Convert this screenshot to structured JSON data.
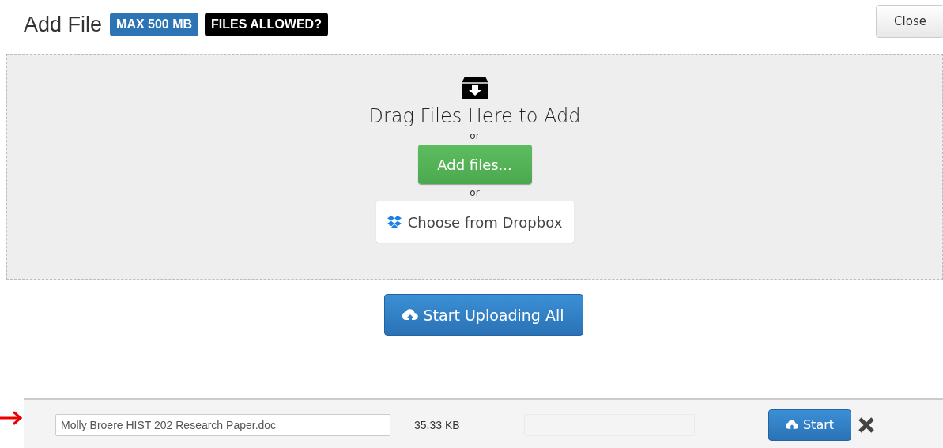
{
  "header": {
    "title": "Add File",
    "badges": [
      {
        "label": "MAX 500 MB",
        "kind": "size"
      },
      {
        "label": "FILES ALLOWED?",
        "kind": "types"
      }
    ],
    "close_button": "Close"
  },
  "dropzone": {
    "heading": "Drag Files Here to Add",
    "separator_1": "or",
    "add_button": "Add files...",
    "separator_2": "or",
    "dropbox_button": "Choose from Dropbox"
  },
  "upload_all_button": "Start Uploading All",
  "files": [
    {
      "name": "Molly Broere HIST 202 Research Paper.doc",
      "size": "35.33 KB",
      "level": 0,
      "start_button": "Start",
      "marked": true
    }
  ]
}
